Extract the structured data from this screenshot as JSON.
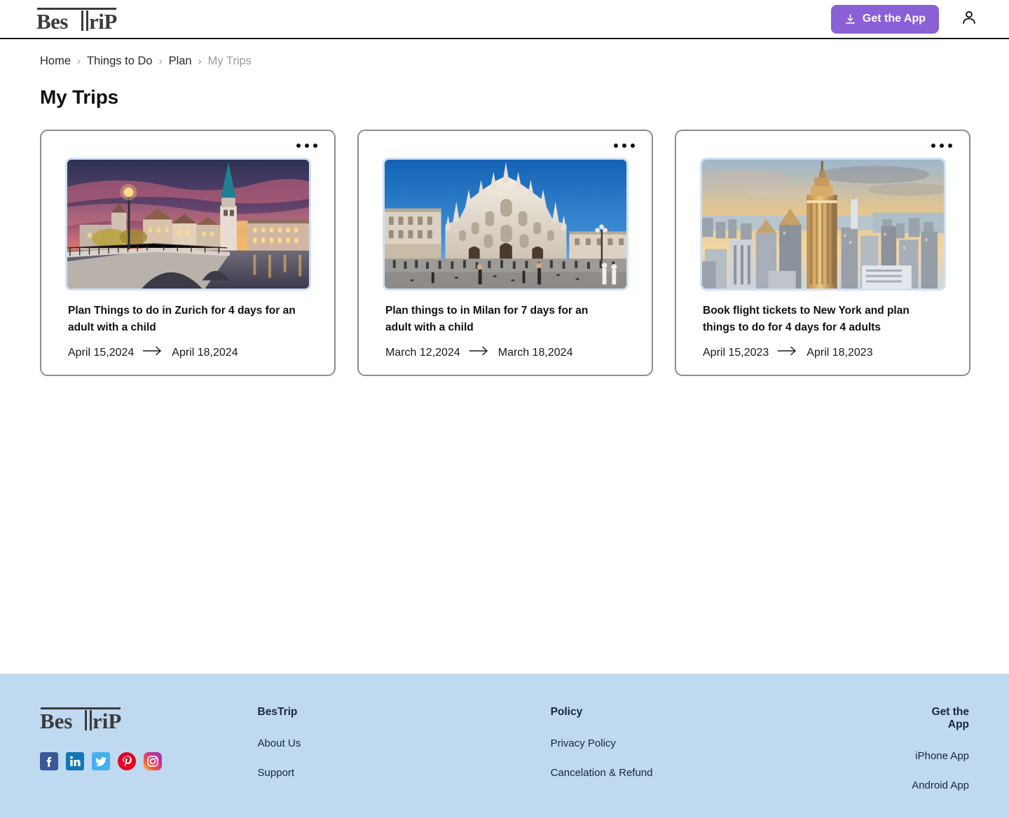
{
  "header": {
    "logo_left": "Bes",
    "logo_right": "riP",
    "get_app_label": "Get the App",
    "download_icon": "download-icon",
    "account_icon": "user-account-icon"
  },
  "breadcrumb": {
    "items": [
      {
        "label": "Home"
      },
      {
        "label": "Things to Do"
      },
      {
        "label": "Plan"
      },
      {
        "label": "My Trips"
      }
    ],
    "separator": "›"
  },
  "main": {
    "page_title": "My Trips",
    "menu_icon": "more-options-icon",
    "arrow_icon": "arrow-right-icon",
    "cards": [
      {
        "image_name": "zurich-sunset-bridge-photo",
        "title": "Plan Things to do in Zurich for 4 days for an adult with a child",
        "start_date": "April 15,2024",
        "end_date": "April 18,2024"
      },
      {
        "image_name": "milan-duomo-cathedral-photo",
        "title": "Plan things to in Milan for 7 days for an adult with a child",
        "start_date": "March 12,2024",
        "end_date": "March 18,2024"
      },
      {
        "image_name": "new-york-skyline-photo",
        "title": "Book flight tickets to New York and plan things to do for 4 days for 4 adults",
        "start_date": "April 15,2023",
        "end_date": "April 18,2023"
      }
    ]
  },
  "footer": {
    "logo_left": "Bes",
    "logo_right": "riP",
    "socials": [
      {
        "name": "facebook-icon"
      },
      {
        "name": "linkedin-icon"
      },
      {
        "name": "twitter-icon"
      },
      {
        "name": "pinterest-icon"
      },
      {
        "name": "instagram-icon"
      }
    ],
    "columns": [
      {
        "heading": "BesTrip",
        "links": [
          {
            "label": "About Us"
          },
          {
            "label": "Support"
          }
        ]
      },
      {
        "heading": "Policy",
        "links": [
          {
            "label": "Privacy Policy"
          },
          {
            "label": "Cancelation & Refund"
          }
        ]
      },
      {
        "heading": "Get the App",
        "links": [
          {
            "label": "iPhone App"
          },
          {
            "label": "Android App"
          }
        ]
      }
    ]
  },
  "colors": {
    "accent_purple": "#8b5fd6",
    "footer_bg": "#bfd9f0",
    "card_border": "#8d8d8d",
    "image_frame": "#cfe2f5",
    "muted_text": "#9b9b9b",
    "footer_text": "#17263c"
  }
}
